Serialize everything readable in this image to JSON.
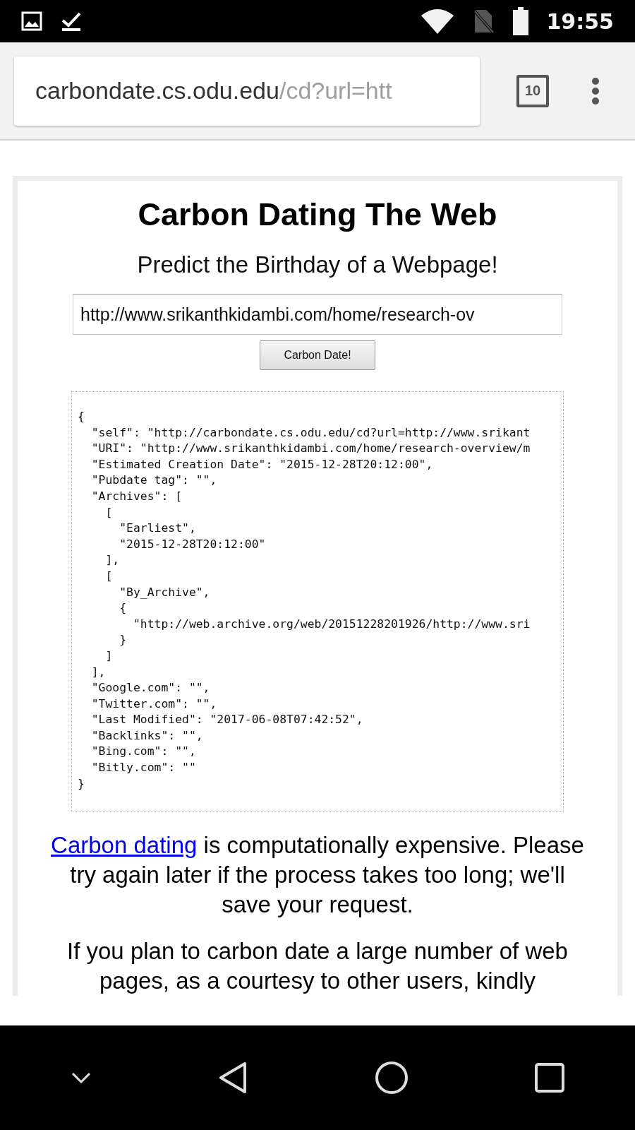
{
  "status_bar": {
    "time": "19:55"
  },
  "toolbar": {
    "url_host": "carbondate.cs.odu.edu",
    "url_path": "/cd?url=htt",
    "tab_count": "10"
  },
  "page": {
    "title": "Carbon Dating The Web",
    "subtitle": "Predict the Birthday of a Webpage!",
    "url_input": {
      "value": "http://www.srikanthkidambi.com/home/research-ov"
    },
    "submit_button": "Carbon Date!",
    "result_lines": [
      "{",
      "  \"self\": \"http://carbondate.cs.odu.edu/cd?url=http://www.srikant",
      "  \"URI\": \"http://www.srikanthkidambi.com/home/research-overview/m",
      "  \"Estimated Creation Date\": \"2015-12-28T20:12:00\",",
      "  \"Pubdate tag\": \"\",",
      "  \"Archives\": [",
      "    [",
      "      \"Earliest\",",
      "      \"2015-12-28T20:12:00\"",
      "    ],",
      "    [",
      "      \"By_Archive\",",
      "      {",
      "        \"http://web.archive.org/web/20151228201926/http://www.sri",
      "      }",
      "    ]",
      "  ],",
      "  \"Google.com\": \"\",",
      "  \"Twitter.com\": \"\",",
      "  \"Last Modified\": \"2017-06-08T07:42:52\",",
      "  \"Backlinks\": \"\",",
      "  \"Bing.com\": \"\",",
      "  \"Bitly.com\": \"\"",
      "}"
    ],
    "notice": {
      "link": "Carbon dating",
      "text": " is computationally expensive. Please try again later if the process takes too long; we'll save your request."
    },
    "notice_2": "If you plan to carbon date a large number of web pages, as a courtesy to other users, kindly"
  }
}
